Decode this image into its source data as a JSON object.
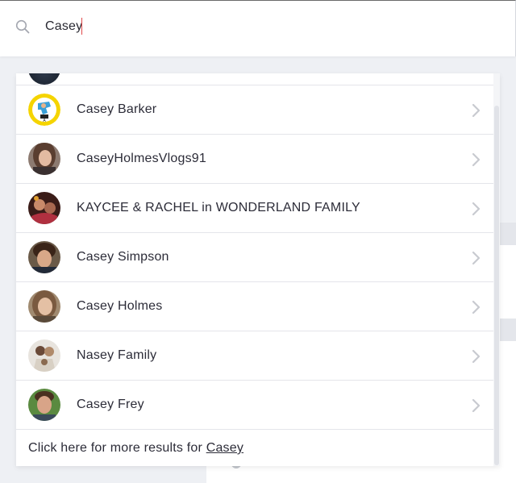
{
  "search": {
    "query": "Casey",
    "icon": "search-icon"
  },
  "results": [
    {
      "label": "Casey Barker",
      "avatar_color": "#f5d400"
    },
    {
      "label": "CaseyHolmesVlogs91",
      "avatar_color": "#6e5a52"
    },
    {
      "label": "KAYCEE & RACHEL in WONDERLAND FAMILY",
      "avatar_color": "#4a2a22"
    },
    {
      "label": "Casey Simpson",
      "avatar_color": "#3d2b24"
    },
    {
      "label": "Casey Holmes",
      "avatar_color": "#8c7058"
    },
    {
      "label": "Nasey Family",
      "avatar_color": "#c8bfb4"
    },
    {
      "label": "Casey Frey",
      "avatar_color": "#4f7a3a"
    }
  ],
  "more_results": {
    "prefix": "Click here for more results for ",
    "link_text": "Casey"
  },
  "colors": {
    "caret": "#e0494a",
    "divider": "#e4e5ea",
    "chevron": "#c8cad0"
  }
}
